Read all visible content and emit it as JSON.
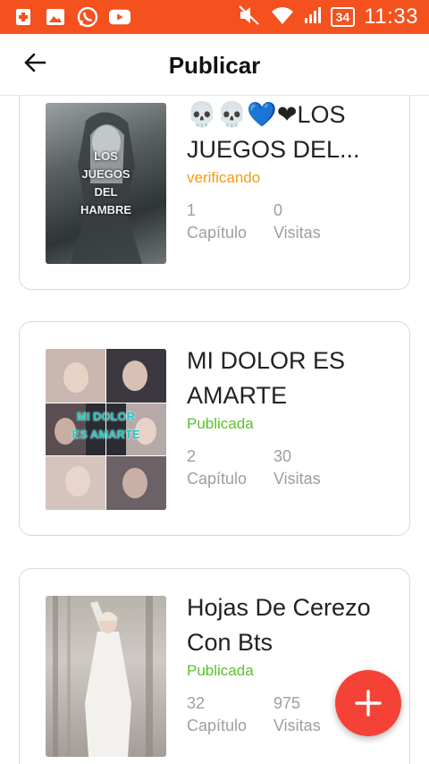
{
  "status_bar": {
    "time": "11:33",
    "battery": "34",
    "icons": [
      "notification-icon",
      "gallery-icon",
      "whatsapp-icon",
      "youtube-icon",
      "mute-icon",
      "wifi-icon",
      "signal-icon"
    ]
  },
  "appbar": {
    "title": "Publicar",
    "back_icon": "arrow-left-icon"
  },
  "stories": [
    {
      "title": "💀💀💙❤LOS JUEGOS DEL...",
      "status": "verificando",
      "status_color": "#f39c12",
      "chapters": "1",
      "chapters_label": "Capítulo",
      "views": "0",
      "views_label": "Visitas",
      "cover_text": "LOS\nJUEGOS\nDEL\nHAMBRE"
    },
    {
      "title": "MI DOLOR ES AMARTE",
      "status": "Publicada",
      "status_color": "#5cc12a",
      "chapters": "2",
      "chapters_label": "Capítulo",
      "views": "30",
      "views_label": "Visitas",
      "cover_text": "MI DOLOR\nES AMARTE"
    },
    {
      "title": "Hojas De Cerezo Con Bts",
      "status": "Publicada",
      "status_color": "#5cc12a",
      "chapters": "32",
      "chapters_label": "Capítulo",
      "views": "975",
      "views_label": "Visitas"
    }
  ],
  "fab": {
    "icon": "plus-icon"
  },
  "colors": {
    "status_bar": "#f4511e",
    "fab": "#f44336",
    "card_border": "#d9d9d9"
  }
}
